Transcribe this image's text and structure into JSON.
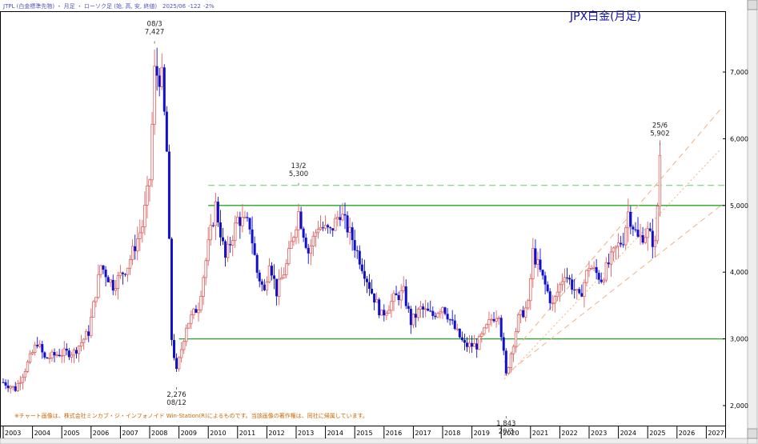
{
  "header": {
    "instrument": "JTPL (白金標準先物) ・ 月足 ・ ローソク足 (始, 高, 安, 終値)",
    "period": "2025/06",
    "change": "-122",
    "change_pct": "-2%"
  },
  "colors": {
    "up_candle": "#e06060",
    "down_candle": "#1010cc",
    "support_line": "#22aa22",
    "dashed_line": "#66cc66",
    "channel_line": "#f0b080",
    "title_color": "#1010aa",
    "header_color": "#5050c0",
    "frame": "#000000"
  },
  "chart_data": {
    "type": "candlestick",
    "title": "JPX白金(月足)",
    "xlabel": "",
    "ylabel": "",
    "x_start": "2003-01",
    "x_end": "2027-12",
    "ylim": [
      1700,
      7900
    ],
    "yticks": [
      2000,
      3000,
      4000,
      5000,
      6000,
      7000
    ],
    "ytick_labels": [
      "2,000",
      "3,000",
      "4,000",
      "5,000",
      "6,000",
      "7,000"
    ],
    "xticks": [
      "2003",
      "2004",
      "2005",
      "2006",
      "2007",
      "2008",
      "2009",
      "2010",
      "2011",
      "2012",
      "2013",
      "2014",
      "2015",
      "2016",
      "2017",
      "2018",
      "2019",
      "2020",
      "2021",
      "2022",
      "2023",
      "2024",
      "2025",
      "2026",
      "2027"
    ],
    "grid": false,
    "price_path": [
      [
        "2003-01",
        2350
      ],
      [
        "2003-06",
        2250
      ],
      [
        "2003-10",
        2550
      ],
      [
        "2004-03",
        2950
      ],
      [
        "2004-06",
        2700
      ],
      [
        "2004-12",
        2780
      ],
      [
        "2005-06",
        2800
      ],
      [
        "2005-12",
        3100
      ],
      [
        "2006-05",
        4100
      ],
      [
        "2006-10",
        3800
      ],
      [
        "2007-04",
        4100
      ],
      [
        "2007-10",
        4700
      ],
      [
        "2008-01",
        5400
      ],
      [
        "2008-03",
        7000
      ],
      [
        "2008-06",
        6900
      ],
      [
        "2008-08",
        5800
      ],
      [
        "2008-10",
        3000
      ],
      [
        "2008-12",
        2500
      ],
      [
        "2009-04",
        3200
      ],
      [
        "2009-09",
        3500
      ],
      [
        "2010-01",
        4400
      ],
      [
        "2010-04",
        5000
      ],
      [
        "2010-08",
        4200
      ],
      [
        "2011-01",
        4800
      ],
      [
        "2011-06",
        4700
      ],
      [
        "2011-09",
        4000
      ],
      [
        "2011-12",
        3700
      ],
      [
        "2012-02",
        4200
      ],
      [
        "2012-05",
        3700
      ],
      [
        "2012-09",
        4100
      ],
      [
        "2013-02",
        4900
      ],
      [
        "2013-06",
        4300
      ],
      [
        "2013-10",
        4700
      ],
      [
        "2014-03",
        4600
      ],
      [
        "2014-07",
        4900
      ],
      [
        "2014-12",
        4500
      ],
      [
        "2015-03",
        4200
      ],
      [
        "2015-08",
        3700
      ],
      [
        "2015-12",
        3350
      ],
      [
        "2016-05",
        3600
      ],
      [
        "2016-09",
        3700
      ],
      [
        "2016-12",
        3250
      ],
      [
        "2017-04",
        3450
      ],
      [
        "2017-09",
        3350
      ],
      [
        "2018-01",
        3500
      ],
      [
        "2018-06",
        3150
      ],
      [
        "2018-10",
        2900
      ],
      [
        "2019-03",
        2900
      ],
      [
        "2019-09",
        3300
      ],
      [
        "2019-12",
        3400
      ],
      [
        "2020-03",
        2450
      ],
      [
        "2020-08",
        3300
      ],
      [
        "2020-12",
        3500
      ],
      [
        "2021-02",
        4300
      ],
      [
        "2021-06",
        3900
      ],
      [
        "2021-10",
        3500
      ],
      [
        "2022-03",
        4000
      ],
      [
        "2022-09",
        3600
      ],
      [
        "2023-01",
        4100
      ],
      [
        "2023-06",
        3900
      ],
      [
        "2023-12",
        4350
      ],
      [
        "2024-03",
        4500
      ],
      [
        "2024-05",
        4900
      ],
      [
        "2024-09",
        4500
      ],
      [
        "2025-01",
        4600
      ],
      [
        "2025-04",
        4400
      ],
      [
        "2025-05",
        5000
      ],
      [
        "2025-06",
        5750
      ]
    ],
    "horizontal_lines": [
      {
        "value": 5000,
        "style": "solid"
      },
      {
        "value": 3000,
        "style": "solid"
      },
      {
        "value": 5300,
        "style": "dashed"
      }
    ],
    "annotations": [
      {
        "date": "2008-03",
        "line1": "08/3",
        "line2": "7,427",
        "value": 7427,
        "position": "above"
      },
      {
        "date": "2008-12",
        "line1": "2,276",
        "line2": "08/12",
        "value": 2276,
        "position": "below"
      },
      {
        "date": "2013-02",
        "line1": "13/2",
        "line2": "5,300",
        "value": 5300,
        "position": "above"
      },
      {
        "date": "2020-03",
        "line1": "1,843",
        "line2": "20/3",
        "value": 1843,
        "position": "below"
      },
      {
        "date": "2025-06",
        "line1": "25/6",
        "line2": "5,902",
        "value": 5902,
        "position": "above"
      }
    ]
  },
  "footer": {
    "note": "※チャート画像は、株式会社ミンカブ・ジ・インフォノイド Win-Station(R)によるものです。当該画像の著作権は、同社に帰属しています。"
  }
}
